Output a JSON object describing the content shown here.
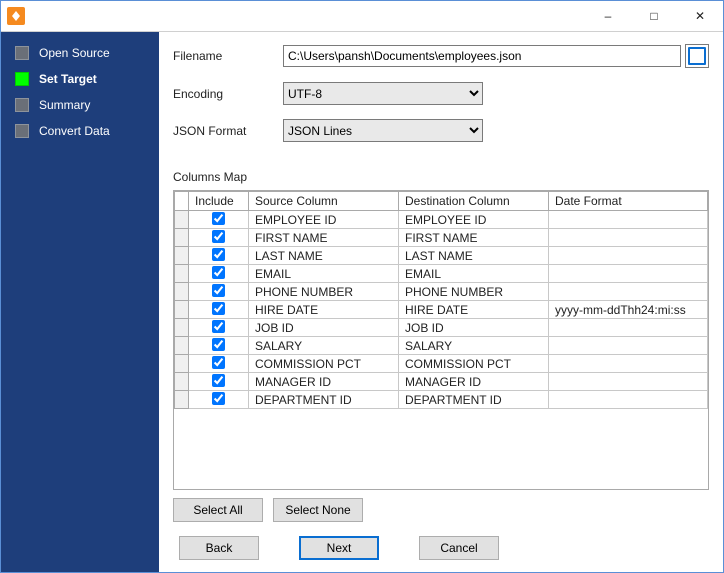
{
  "titlebar": {
    "app_icon_name": "app"
  },
  "sidebar": {
    "steps": [
      {
        "label": "Open Source"
      },
      {
        "label": "Set Target"
      },
      {
        "label": "Summary"
      },
      {
        "label": "Convert Data"
      }
    ],
    "active_index": 1
  },
  "form": {
    "filename_label": "Filename",
    "filename_value": "C:\\Users\\pansh\\Documents\\employees.json",
    "encoding_label": "Encoding",
    "encoding_value": "UTF-8",
    "json_format_label": "JSON Format",
    "json_format_value": "JSON Lines"
  },
  "columns_section": {
    "title": "Columns Map",
    "headers": {
      "include": "Include",
      "source": "Source Column",
      "destination": "Destination Column",
      "dateformat": "Date Format"
    },
    "rows": [
      {
        "include": true,
        "source": "EMPLOYEE ID",
        "destination": "EMPLOYEE ID",
        "dateformat": ""
      },
      {
        "include": true,
        "source": "FIRST NAME",
        "destination": "FIRST NAME",
        "dateformat": ""
      },
      {
        "include": true,
        "source": "LAST NAME",
        "destination": "LAST NAME",
        "dateformat": ""
      },
      {
        "include": true,
        "source": "EMAIL",
        "destination": "EMAIL",
        "dateformat": ""
      },
      {
        "include": true,
        "source": "PHONE NUMBER",
        "destination": "PHONE NUMBER",
        "dateformat": ""
      },
      {
        "include": true,
        "source": "HIRE DATE",
        "destination": "HIRE DATE",
        "dateformat": "yyyy-mm-ddThh24:mi:ss"
      },
      {
        "include": true,
        "source": "JOB ID",
        "destination": "JOB ID",
        "dateformat": ""
      },
      {
        "include": true,
        "source": "SALARY",
        "destination": "SALARY",
        "dateformat": ""
      },
      {
        "include": true,
        "source": "COMMISSION PCT",
        "destination": "COMMISSION PCT",
        "dateformat": ""
      },
      {
        "include": true,
        "source": "MANAGER ID",
        "destination": "MANAGER ID",
        "dateformat": ""
      },
      {
        "include": true,
        "source": "DEPARTMENT ID",
        "destination": "DEPARTMENT ID",
        "dateformat": ""
      }
    ],
    "select_all_label": "Select All",
    "select_none_label": "Select None"
  },
  "nav": {
    "back_label": "Back",
    "next_label": "Next",
    "cancel_label": "Cancel"
  }
}
